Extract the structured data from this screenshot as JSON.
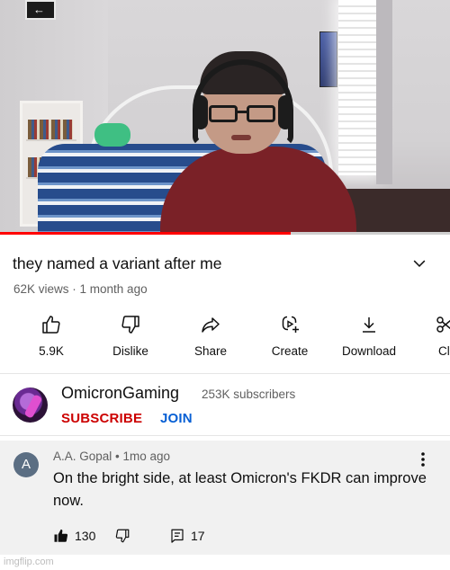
{
  "video": {
    "progress_fraction": 0.645,
    "progress_color": "#ff0000"
  },
  "info": {
    "title": "they named a variant after me",
    "meta": "62K views · 1 month ago",
    "expand_icon": "chevron-down-icon"
  },
  "actions": [
    {
      "icon": "thumbs-up-icon",
      "label": "5.9K"
    },
    {
      "icon": "thumbs-down-icon",
      "label": "Dislike"
    },
    {
      "icon": "share-icon",
      "label": "Share"
    },
    {
      "icon": "create-icon",
      "label": "Create"
    },
    {
      "icon": "download-icon",
      "label": "Download"
    },
    {
      "icon": "clip-icon",
      "label": "Cl"
    }
  ],
  "channel": {
    "name": "OmicronGaming",
    "subscribers": "253K subscribers",
    "subscribe_label": "SUBSCRIBE",
    "join_label": "JOIN",
    "subscribe_color": "#cc0000",
    "join_color": "#065fd4"
  },
  "comment": {
    "avatar_letter": "A",
    "author_line": "A.A. Gopal • 1mo ago",
    "text": "On the bright side, at least Omicron's FKDR can improve now.",
    "likes": "130",
    "replies": "17"
  },
  "watermark": "imgflip.com"
}
